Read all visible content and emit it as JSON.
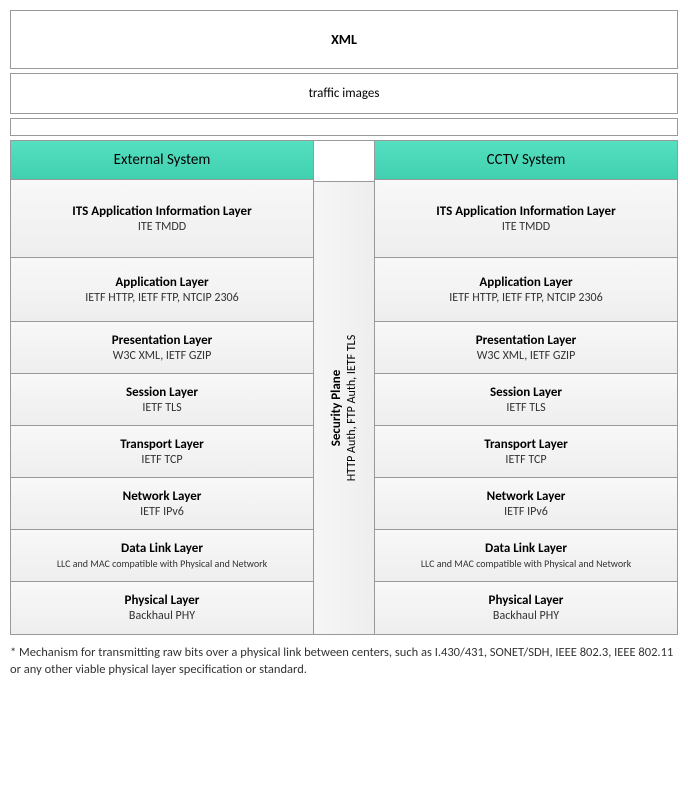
{
  "top_label": "XML",
  "traffic_label": "traffic images",
  "left_header": "External System",
  "right_header": "CCTV System",
  "security": {
    "title": "Security Plane",
    "sub": "HTTP Auth, FTP Auth, IETF TLS"
  },
  "layers": [
    {
      "title": "ITS Application Information Layer",
      "sub": "ITE TMDD",
      "size": "tall"
    },
    {
      "title": "Application Layer",
      "sub": "IETF HTTP, IETF FTP, NTCIP 2306",
      "size": "med"
    },
    {
      "title": "Presentation Layer",
      "sub": "W3C XML, IETF GZIP",
      "size": "norm"
    },
    {
      "title": "Session Layer",
      "sub": "IETF TLS",
      "size": "norm"
    },
    {
      "title": "Transport Layer",
      "sub": "IETF TCP",
      "size": "norm"
    },
    {
      "title": "Network Layer",
      "sub": "IETF IPv6",
      "size": "norm"
    },
    {
      "title": "Data Link Layer",
      "sub": "LLC and MAC compatible with Physical and Network",
      "size": "norm",
      "small": true
    },
    {
      "title": "Physical Layer",
      "sub": "Backhaul PHY",
      "size": "norm"
    }
  ],
  "footnote": "* Mechanism for transmitting raw bits over a physical link between centers, such as I.430/431, SONET/SDH, IEEE 802.3, IEEE 802.11 or any other viable physical layer specification or standard."
}
